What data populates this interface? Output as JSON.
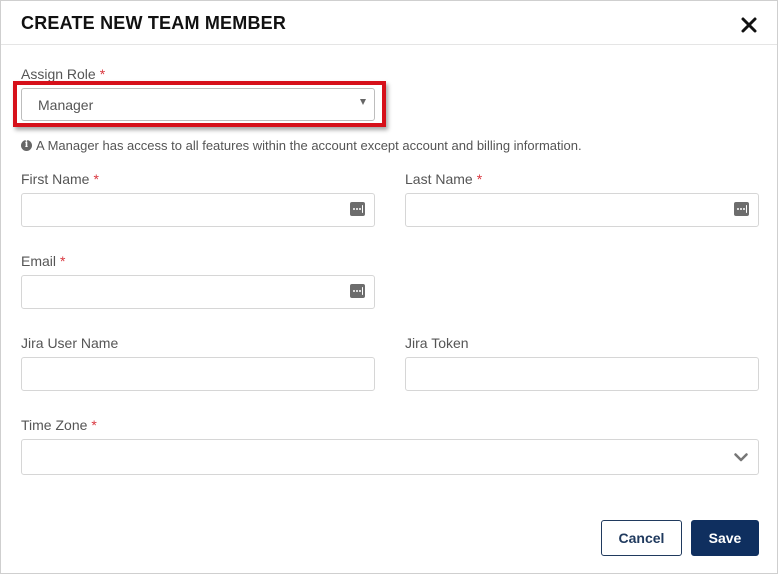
{
  "dialog": {
    "title": "CREATE NEW TEAM MEMBER"
  },
  "role": {
    "label": "Assign Role",
    "required_mark": "*",
    "selected": "Manager",
    "hint": "A Manager has access to all features within the account except account and billing information."
  },
  "fields": {
    "first_name": {
      "label": "First Name",
      "required_mark": "*",
      "value": ""
    },
    "last_name": {
      "label": "Last Name",
      "required_mark": "*",
      "value": ""
    },
    "email": {
      "label": "Email",
      "required_mark": "*",
      "value": ""
    },
    "jira_user_name": {
      "label": "Jira User Name",
      "value": ""
    },
    "jira_token": {
      "label": "Jira Token",
      "value": ""
    }
  },
  "time_zone": {
    "label": "Time Zone",
    "required_mark": "*",
    "selected": ""
  },
  "buttons": {
    "cancel": "Cancel",
    "save": "Save"
  },
  "icons": {
    "close": "close-icon",
    "info": "info-icon",
    "password_manager": "password-manager-key-icon",
    "chevron": "chevron-down-icon",
    "caret": "caret-down-icon"
  },
  "colors": {
    "primary": "#0f2f5f",
    "required": "#d9363e",
    "highlight": "#d6101a"
  }
}
